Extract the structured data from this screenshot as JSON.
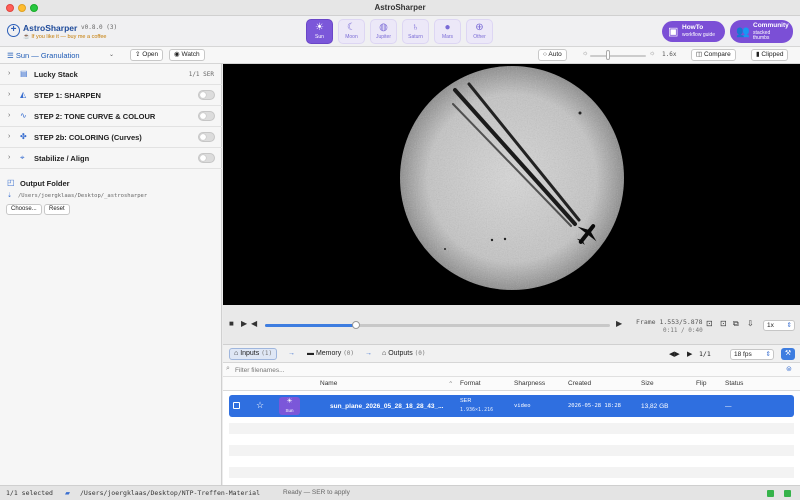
{
  "window": {
    "title": "AstroSharper"
  },
  "header": {
    "app_name": "AstroSharper",
    "version": "v0.8.0 (3)",
    "tagline": "If you like it — buy me a coffee",
    "targets": [
      {
        "label": "Sun",
        "icon": "sun-icon",
        "active": true
      },
      {
        "label": "Moon",
        "icon": "moon-icon",
        "active": false
      },
      {
        "label": "Jupiter",
        "icon": "jupiter-icon",
        "active": false
      },
      {
        "label": "Saturn",
        "icon": "saturn-icon",
        "active": false
      },
      {
        "label": "Mars",
        "icon": "mars-icon",
        "active": false
      },
      {
        "label": "Other",
        "icon": "target-icon",
        "active": false
      }
    ],
    "howto": {
      "title": "HowTo",
      "subtitle": "workflow guide"
    },
    "community": {
      "title": "Community",
      "subtitle": "stacked thumbs"
    }
  },
  "toolbar": {
    "preset": "Sun — Granulation",
    "open_label": "Open",
    "watch_label": "Watch",
    "auto_label": "Auto",
    "zoom_value": "1.6x",
    "compare_label": "Compare",
    "clipped_label": "Clipped"
  },
  "sidebar": {
    "stages": [
      {
        "label": "Lucky Stack",
        "count": "1/1 SER",
        "icon": "stack-icon"
      },
      {
        "label": "STEP 1: SHARPEN",
        "icon": "sharpen-icon"
      },
      {
        "label": "STEP 2: TONE CURVE & COLOUR",
        "icon": "curve-icon"
      },
      {
        "label": "STEP 2b: COLORING (Curves)",
        "icon": "palette-icon"
      },
      {
        "label": "Stabilize / Align",
        "icon": "target-icon"
      }
    ],
    "output_title": "Output Folder",
    "output_path": "/Users/joergklaas/Desktop/_astrosharper",
    "choose_label": "Choose...",
    "reset_label": "Reset"
  },
  "playback": {
    "frame_label": "Frame 1.553/5.878",
    "time_label": "0:11 / 0:40",
    "progress": 0.264,
    "speed": "1x"
  },
  "tabs": {
    "inputs": {
      "label": "Inputs",
      "count": "(1)"
    },
    "memory": {
      "label": "Memory",
      "count": "(0)"
    },
    "outputs": {
      "label": "Outputs",
      "count": "(0)"
    },
    "page": "1/1",
    "fps": "18 fps"
  },
  "filter": {
    "placeholder": "Filter filenames..."
  },
  "table": {
    "columns": [
      "Name",
      "Format",
      "Sharpness",
      "Created",
      "Size",
      "Flip",
      "Status"
    ],
    "rows": [
      {
        "thumb_label": "Sun",
        "name": "sun_plane_2026_05_28_18_28_43_...",
        "format": "SER",
        "format_sub": "1.936×1.216",
        "sharpness": "video",
        "created": "2026-05-28 18:28",
        "size": "13,82 GB",
        "flip": "",
        "status": "—"
      }
    ]
  },
  "statusbar": {
    "selected": "1/1 selected",
    "path": "/Users/joergklaas/Desktop/NTP-Treffen-Material",
    "status": "Ready — SER to apply"
  }
}
